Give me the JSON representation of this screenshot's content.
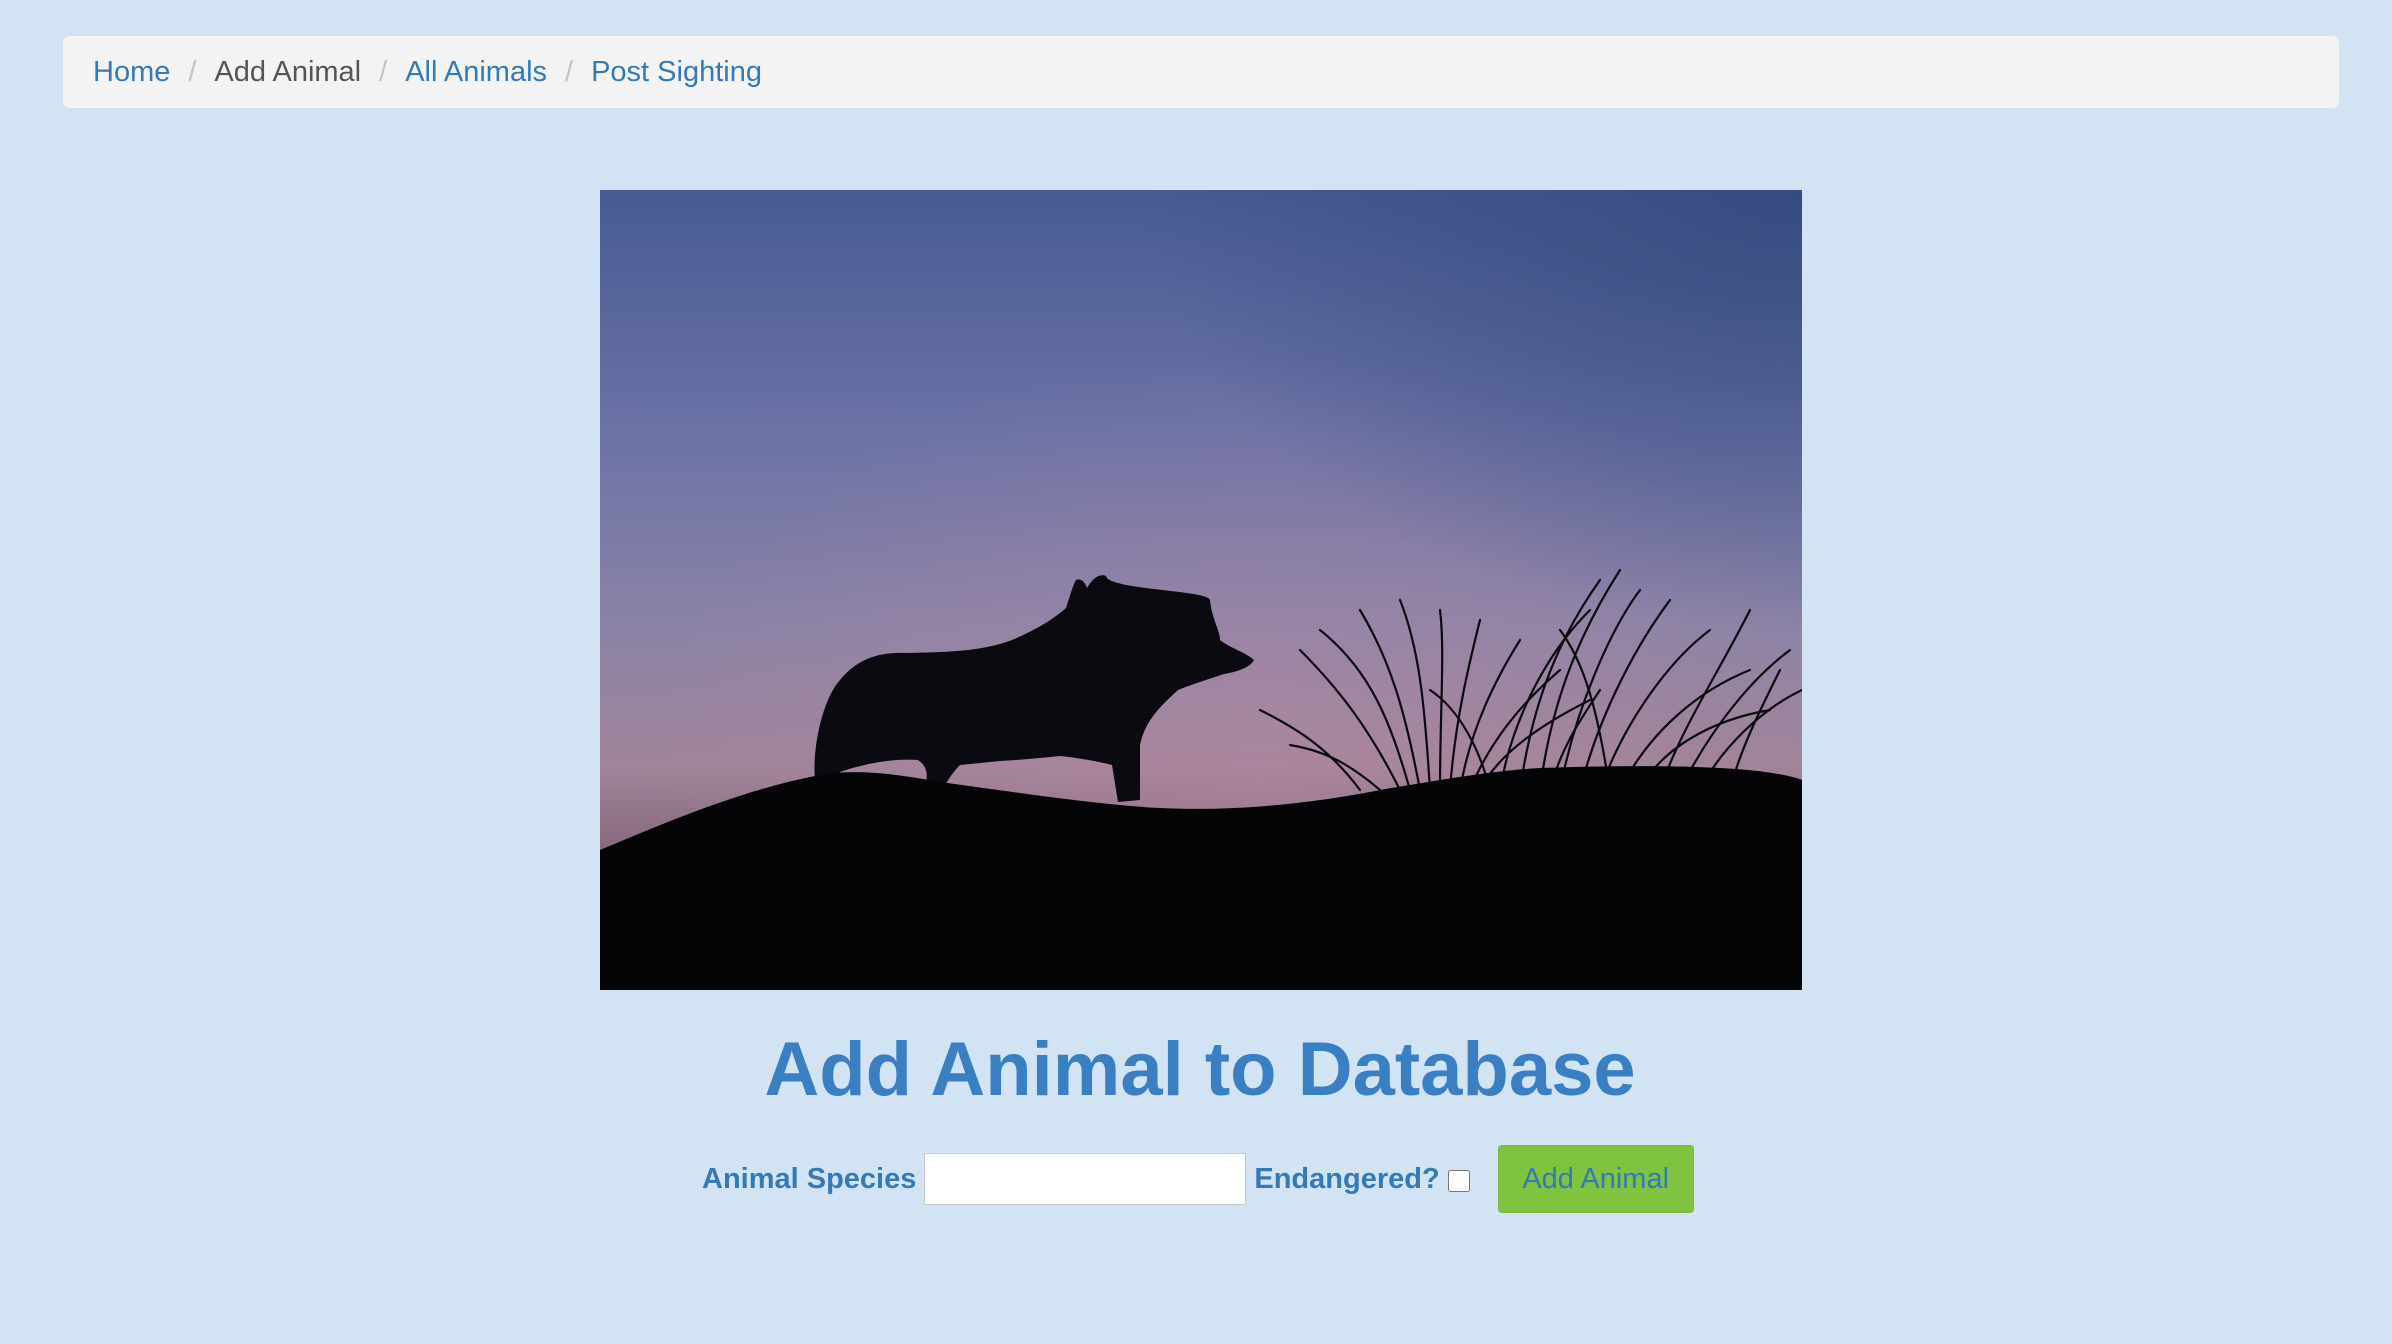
{
  "breadcrumb": {
    "home": "Home",
    "add_animal": "Add Animal",
    "all_animals": "All Animals",
    "post_sighting": "Post Sighting",
    "separator": "/"
  },
  "main": {
    "title": "Add Animal to Database",
    "species_label": "Animal Species",
    "species_value": "",
    "endangered_label": "Endangered?",
    "endangered_checked": false,
    "add_button_label": "Add Animal"
  },
  "colors": {
    "background": "#d2e3f4",
    "link": "#337ab7",
    "button": "#80c341"
  }
}
